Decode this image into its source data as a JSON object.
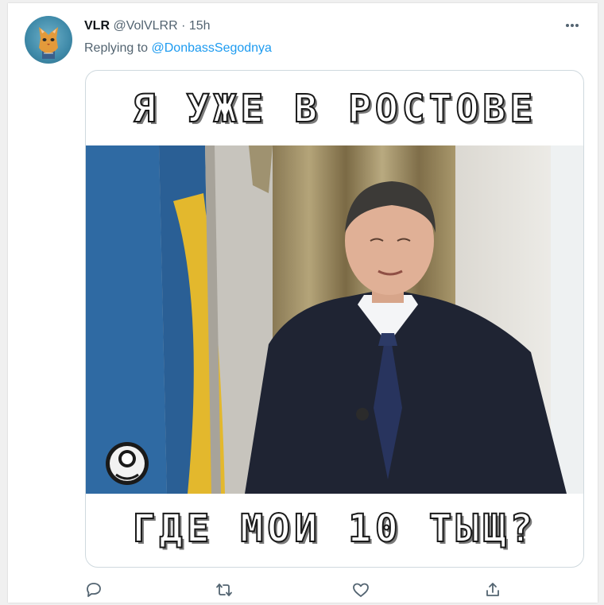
{
  "tweet": {
    "display_name": "VLR",
    "handle": "@VolVLRR",
    "separator": "·",
    "time": "15h",
    "replying_to_label": "Replying to",
    "replying_to_handle": "@DonbassSegodnya"
  },
  "media": {
    "top_caption": "Я УЖЕ В РОСТОВЕ",
    "bottom_caption": "ГДЕ МОИ 10 ТЫЩ?"
  },
  "actions": {
    "icons": [
      "reply-icon",
      "retweet-icon",
      "like-icon",
      "share-icon"
    ]
  },
  "colors": {
    "accent": "#1d9bf0",
    "muted_text": "#536471",
    "primary_text": "#0f1419",
    "border": "#cfd9de"
  }
}
